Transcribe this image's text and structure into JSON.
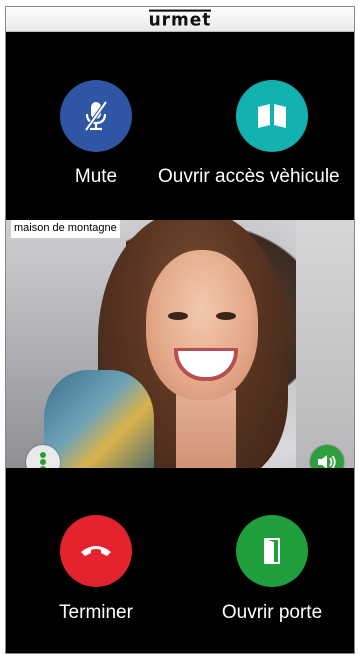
{
  "brand": {
    "name": "urmet"
  },
  "actions": {
    "mute": {
      "label": "Mute",
      "icon": "mic-off-icon",
      "color": "#2e56a5"
    },
    "vehicle": {
      "label": "Ouvrir accès vèhicule",
      "icon": "gate-icon",
      "color": "#13b1b0"
    },
    "hangup": {
      "label": "Terminer",
      "icon": "phone-hangup-icon",
      "color": "#e3232d"
    },
    "door": {
      "label": "Ouvrir porte",
      "icon": "door-icon",
      "color": "#1f9e3d"
    }
  },
  "video": {
    "caption": "maison de montagne",
    "more_icon": "more-vertical-icon",
    "volume_icon": "volume-icon",
    "volume_color": "#2d9f3e"
  }
}
